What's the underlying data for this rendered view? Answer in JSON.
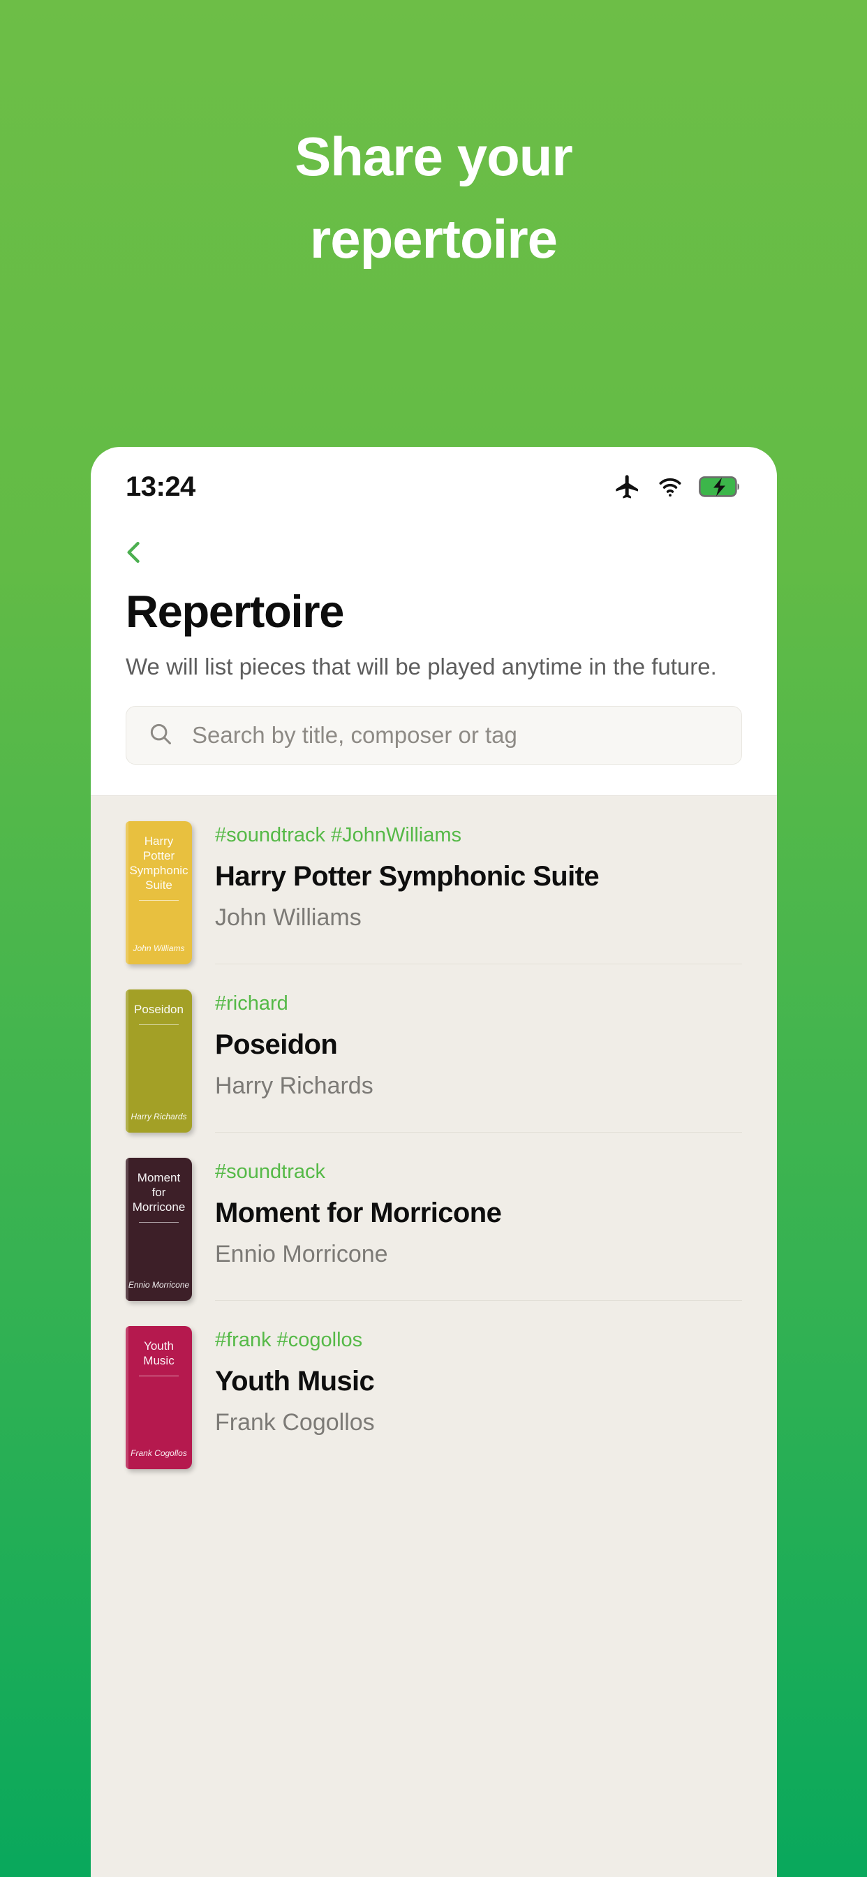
{
  "promo": {
    "lines": [
      "Share your",
      "repertoire"
    ]
  },
  "colors": {
    "brand_green": "#62bb46",
    "accent_green": "#55b947",
    "page_bg": "#f0ede7",
    "card_bg": "#ffffff"
  },
  "statusbar": {
    "time": "13:24",
    "icons": [
      "airplane-mode-icon",
      "wifi-icon",
      "battery-charging-icon"
    ],
    "battery_state": "charging"
  },
  "header": {
    "back_icon": "chevron-left-icon",
    "title": "Repertoire",
    "subtitle": "We will list pieces that will be played anytime in the future."
  },
  "search": {
    "icon": "search-icon",
    "placeholder": "Search by title, composer or tag",
    "value": ""
  },
  "list": {
    "items": [
      {
        "tags": "#soundtrack #JohnWilliams",
        "title": "Harry Potter Symphonic Suite",
        "composer": "John Williams",
        "thumb_title": "Harry Potter Symphonic Suite",
        "thumb_composer": "John Williams",
        "thumb_color": "#e8c03f"
      },
      {
        "tags": "#richard",
        "title": "Poseidon",
        "composer": "Harry Richards",
        "thumb_title": "Poseidon",
        "thumb_composer": "Harry Richards",
        "thumb_color": "#a3a026"
      },
      {
        "tags": "#soundtrack",
        "title": "Moment for Morricone",
        "composer": "Ennio Morricone",
        "thumb_title": "Moment for Morricone",
        "thumb_composer": "Ennio Morricone",
        "thumb_color": "#3d1f28"
      },
      {
        "tags": "#frank #cogollos",
        "title": "Youth Music",
        "composer": "Frank Cogollos",
        "thumb_title": "Youth Music",
        "thumb_composer": "Frank Cogollos",
        "thumb_color": "#b5194e"
      }
    ]
  }
}
